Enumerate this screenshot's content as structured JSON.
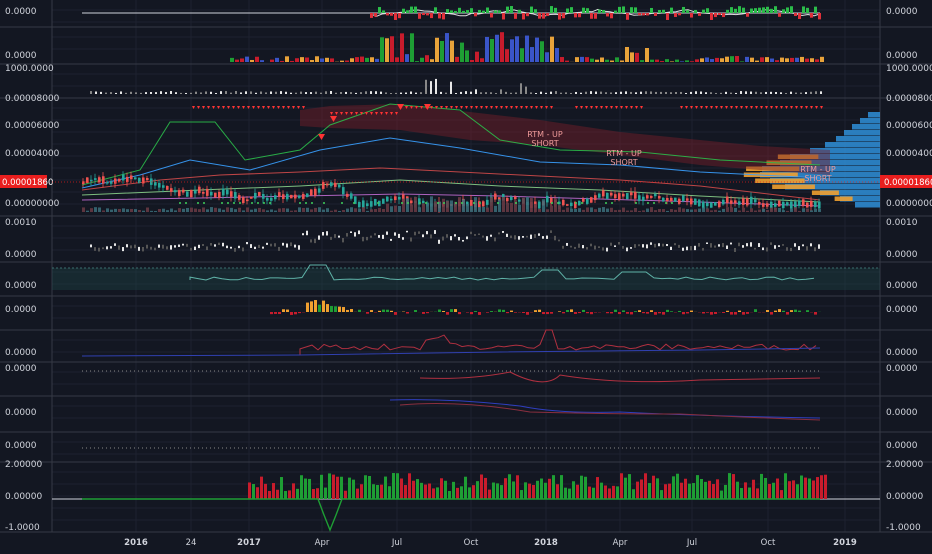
{
  "colors": {
    "background": "#131722",
    "grid": "#1e2230",
    "separator": "#363a45",
    "axis_text": "#d1d4dc",
    "up": "#26a69a",
    "down": "#ef5350",
    "vol_up": "#1b8a2e",
    "vol_down": "#c2185b",
    "price_tag": "#e91e1e",
    "signal": "#ff3333",
    "annotation": "#ef9a9a",
    "profile_orange": "#f0a030",
    "profile_blue": "#2f8fd8"
  },
  "time_axis": {
    "labels": [
      {
        "text": "2016",
        "bold": true
      },
      {
        "text": "24",
        "bold": false
      },
      {
        "text": "2017",
        "bold": true
      },
      {
        "text": "Apr",
        "bold": false
      },
      {
        "text": "Jul",
        "bold": false
      },
      {
        "text": "Oct",
        "bold": false
      },
      {
        "text": "2018",
        "bold": true
      },
      {
        "text": "Apr",
        "bold": false
      },
      {
        "text": "Jul",
        "bold": false
      },
      {
        "text": "Oct",
        "bold": false
      },
      {
        "text": "2019",
        "bold": true
      }
    ]
  },
  "panes": [
    {
      "name": "pane-1",
      "labels": [
        "0.0000"
      ],
      "right_labels": [
        "0.0000"
      ]
    },
    {
      "name": "pane-2",
      "labels": [
        "0.0000"
      ],
      "right_labels": [
        "0.0000"
      ]
    },
    {
      "name": "pane-3",
      "labels": [
        "1000.0000"
      ],
      "right_labels": [
        "1000.0000"
      ]
    },
    {
      "name": "main-price-pane",
      "labels": [
        "0.00008000",
        "0.00006000",
        "0.00004000",
        "0.00000000"
      ],
      "right_labels": [
        "0.00008000",
        "0.00006000",
        "0.00004000",
        "0.00000000"
      ]
    },
    {
      "name": "pane-5",
      "labels": [
        "0.0010",
        "0.0000"
      ],
      "right_labels": [
        "0.0010",
        "0.0000"
      ]
    },
    {
      "name": "pane-6",
      "labels": [
        "0.0000"
      ],
      "right_labels": [
        "0.0000"
      ]
    },
    {
      "name": "pane-7",
      "labels": [
        "0.0000"
      ],
      "right_labels": [
        "0.0000"
      ]
    },
    {
      "name": "pane-8",
      "labels": [
        "0.0000"
      ],
      "right_labels": [
        "0.0000"
      ]
    },
    {
      "name": "pane-9",
      "labels": [
        "0.0000"
      ],
      "right_labels": [
        "0.0000"
      ]
    },
    {
      "name": "pane-10",
      "labels": [
        "0.0000"
      ],
      "right_labels": [
        "0.0000"
      ]
    },
    {
      "name": "pane-11",
      "labels": [
        "0.0000"
      ],
      "right_labels": [
        "0.0000"
      ]
    },
    {
      "name": "pane-12",
      "labels": [
        "2.00000",
        "0.00000",
        "-1.0000"
      ],
      "right_labels": [
        "2.00000",
        "0.00000",
        "-1.0000"
      ]
    }
  ],
  "price_tag": {
    "value": "0.00001860"
  },
  "annotations": [
    {
      "line1": "RTM - UP",
      "line2": "SHORT"
    },
    {
      "line1": "RTM - UP",
      "line2": "SHORT"
    },
    {
      "line1": "RTM - UP",
      "line2": "SHORT"
    }
  ]
}
